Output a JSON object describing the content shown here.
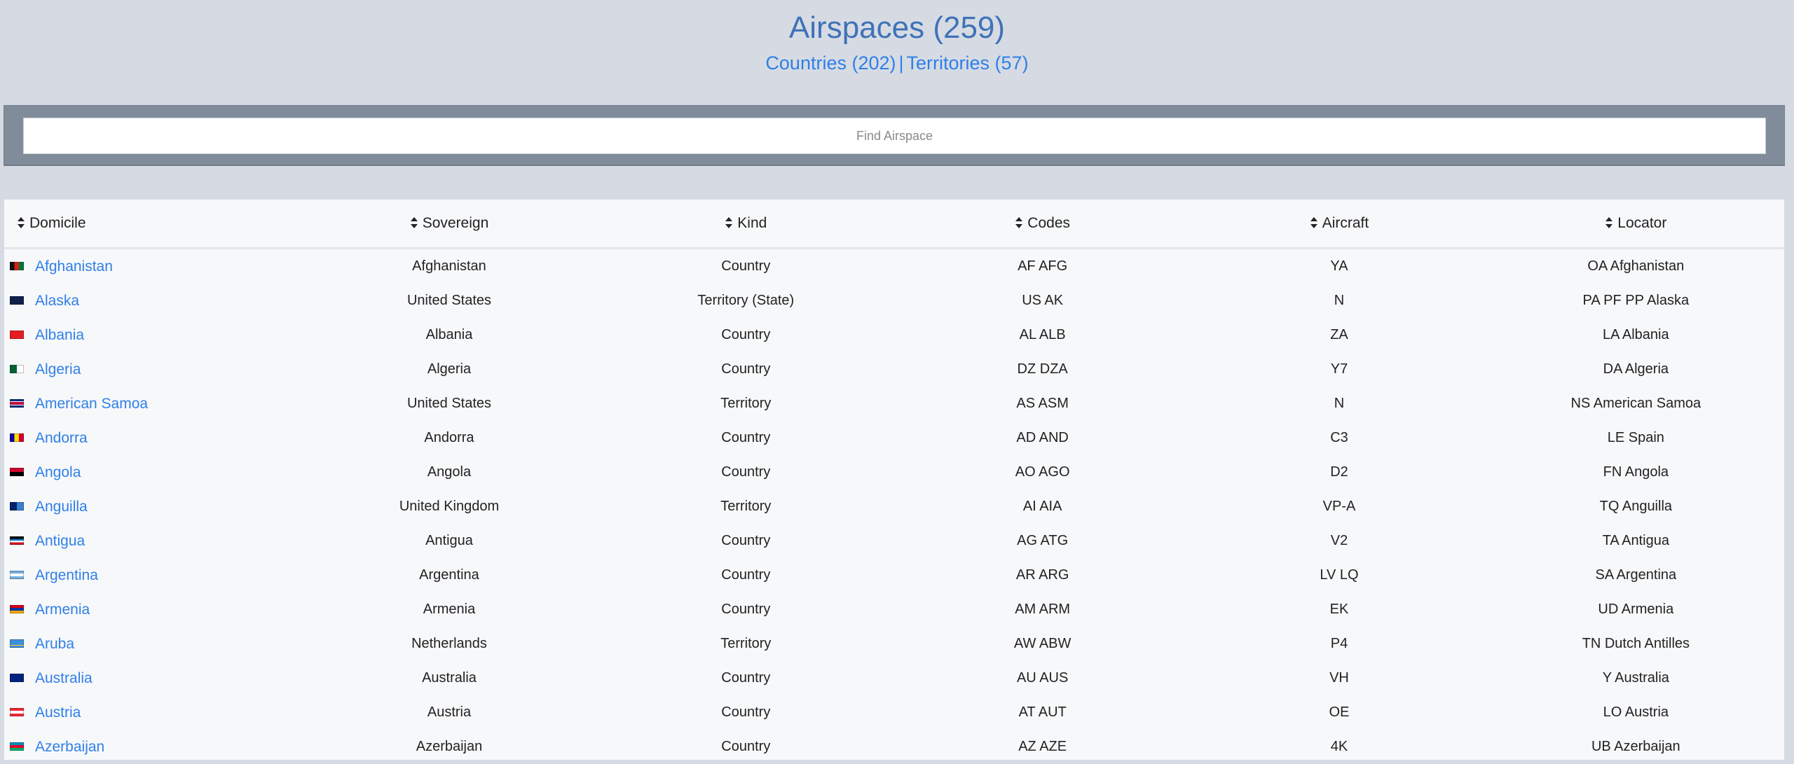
{
  "header": {
    "title": "Airspaces (259)",
    "countries_link": "Countries (202)",
    "separator": "|",
    "territories_link": "Territories (57)"
  },
  "search": {
    "placeholder": "Find Airspace",
    "value": ""
  },
  "colors": {
    "title": "#3f72b8",
    "link": "#2f7fe8",
    "page_bg": "#d6dbe3",
    "searchbar_bg": "#818c9b",
    "table_bg": "#f7f8fa"
  },
  "table": {
    "columns": [
      {
        "label": "Domicile",
        "icon": "sort-icon"
      },
      {
        "label": "Sovereign",
        "icon": "sort-icon"
      },
      {
        "label": "Kind",
        "icon": "sort-icon"
      },
      {
        "label": "Codes",
        "icon": "sort-icon"
      },
      {
        "label": "Aircraft",
        "icon": "sort-icon"
      },
      {
        "label": "Locator",
        "icon": "sort-icon"
      }
    ],
    "rows": [
      {
        "flag": "flag-afghanistan-icon",
        "domicile": "Afghanistan",
        "sovereign": "Afghanistan",
        "kind": "Country",
        "codes": "AF AFG",
        "aircraft": "YA",
        "locator": "OA Afghanistan"
      },
      {
        "flag": "flag-alaska-icon",
        "domicile": "Alaska",
        "sovereign": "United States",
        "kind": "Territory (State)",
        "codes": "US AK",
        "aircraft": "N",
        "locator": "PA PF PP Alaska"
      },
      {
        "flag": "flag-albania-icon",
        "domicile": "Albania",
        "sovereign": "Albania",
        "kind": "Country",
        "codes": "AL ALB",
        "aircraft": "ZA",
        "locator": "LA Albania"
      },
      {
        "flag": "flag-algeria-icon",
        "domicile": "Algeria",
        "sovereign": "Algeria",
        "kind": "Country",
        "codes": "DZ DZA",
        "aircraft": "Y7",
        "locator": "DA Algeria"
      },
      {
        "flag": "flag-american-samoa-icon",
        "domicile": "American Samoa",
        "sovereign": "United States",
        "kind": "Territory",
        "codes": "AS ASM",
        "aircraft": "N",
        "locator": "NS American Samoa"
      },
      {
        "flag": "flag-andorra-icon",
        "domicile": "Andorra",
        "sovereign": "Andorra",
        "kind": "Country",
        "codes": "AD AND",
        "aircraft": "C3",
        "locator": "LE Spain"
      },
      {
        "flag": "flag-angola-icon",
        "domicile": "Angola",
        "sovereign": "Angola",
        "kind": "Country",
        "codes": "AO AGO",
        "aircraft": "D2",
        "locator": "FN Angola"
      },
      {
        "flag": "flag-anguilla-icon",
        "domicile": "Anguilla",
        "sovereign": "United Kingdom",
        "kind": "Territory",
        "codes": "AI AIA",
        "aircraft": "VP-A",
        "locator": "TQ Anguilla"
      },
      {
        "flag": "flag-antigua-icon",
        "domicile": "Antigua",
        "sovereign": "Antigua",
        "kind": "Country",
        "codes": "AG ATG",
        "aircraft": "V2",
        "locator": "TA Antigua"
      },
      {
        "flag": "flag-argentina-icon",
        "domicile": "Argentina",
        "sovereign": "Argentina",
        "kind": "Country",
        "codes": "AR ARG",
        "aircraft": "LV LQ",
        "locator": "SA Argentina"
      },
      {
        "flag": "flag-armenia-icon",
        "domicile": "Armenia",
        "sovereign": "Armenia",
        "kind": "Country",
        "codes": "AM ARM",
        "aircraft": "EK",
        "locator": "UD Armenia"
      },
      {
        "flag": "flag-aruba-icon",
        "domicile": "Aruba",
        "sovereign": "Netherlands",
        "kind": "Territory",
        "codes": "AW ABW",
        "aircraft": "P4",
        "locator": "TN Dutch Antilles"
      },
      {
        "flag": "flag-australia-icon",
        "domicile": "Australia",
        "sovereign": "Australia",
        "kind": "Country",
        "codes": "AU AUS",
        "aircraft": "VH",
        "locator": "Y Australia"
      },
      {
        "flag": "flag-austria-icon",
        "domicile": "Austria",
        "sovereign": "Austria",
        "kind": "Country",
        "codes": "AT AUT",
        "aircraft": "OE",
        "locator": "LO Austria"
      },
      {
        "flag": "flag-azerbaijan-icon",
        "domicile": "Azerbaijan",
        "sovereign": "Azerbaijan",
        "kind": "Country",
        "codes": "AZ AZE",
        "aircraft": "4K",
        "locator": "UB Azerbaijan"
      }
    ]
  }
}
